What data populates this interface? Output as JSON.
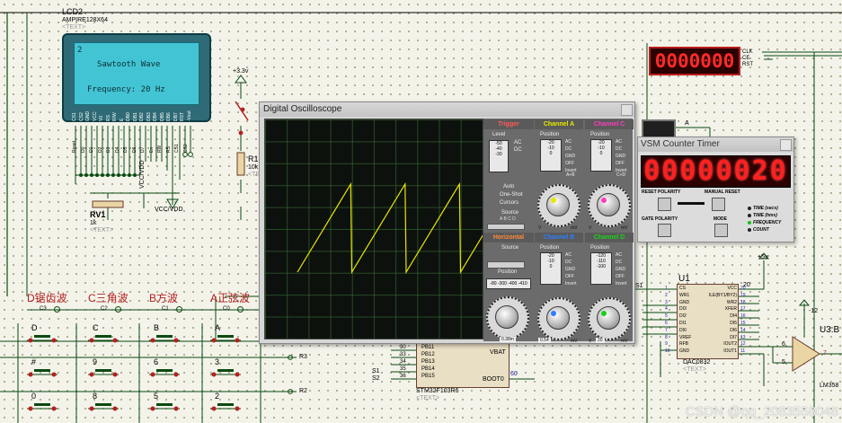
{
  "lcd": {
    "ref": "LCD2",
    "part": "AMPIRE128X64",
    "text_tag": "<TEXT>",
    "line0": "2",
    "line1": "Sawtooth Wave",
    "line2": "Frequency: 20 Hz",
    "pins": [
      "CS1",
      "CS2",
      "GND",
      "VCC",
      "V0",
      "RS",
      "R/W",
      "E",
      "DB0",
      "DB1",
      "DB2",
      "DB3",
      "DB4",
      "DB5",
      "DB6",
      "DB7",
      "RST",
      "-Vout"
    ],
    "nets": [
      "Reset",
      "D0",
      "D1",
      "D2",
      "D3",
      "D4",
      "D5",
      "D6",
      "D7",
      "En",
      "RW",
      "RS",
      "CS1",
      "CS2"
    ]
  },
  "schematic": {
    "supply_3v3": "+3.3v",
    "r1_ref": "R1",
    "r1_val": "10k",
    "r1_tag": "<TEXT>",
    "rv1_ref": "RV1",
    "rv1_val": "1k",
    "rv1_tag": "<TEXT>",
    "vcc_label": "VCC/VDD",
    "vcc_label2": "VCC/VDD",
    "wave_buttons": [
      {
        "title": "D锯齿波",
        "net": "C3"
      },
      {
        "title": "C三角波",
        "net": "C2"
      },
      {
        "title": "B方波",
        "net": "C1"
      },
      {
        "title": "A正弦波",
        "net": "C0"
      }
    ],
    "keypad_row1": [
      "D",
      "C",
      "B",
      "A"
    ],
    "keypad_row2": [
      "#",
      "9",
      "6",
      "3"
    ],
    "keypad_row3": [
      "0",
      "8",
      "5",
      "2"
    ],
    "net_r3": "R3",
    "net_r2": "R2",
    "s1": "S1",
    "s2": "S2",
    "mcu_pins": [
      "PB11",
      "PB12",
      "PB13",
      "PB14",
      "PB15"
    ],
    "mcu_pin_nums": [
      "30",
      "33",
      "34",
      "35",
      "36"
    ],
    "mcu_vbat": "VBAT",
    "mcu_boot": "BOOT0",
    "mcu_boot_num": "60",
    "mcu_part": "STM32F103R6",
    "mcu_tag": "<TEXT>",
    "counter_pins": [
      "CLK",
      "CE",
      "RST"
    ],
    "counter_value": "0000000",
    "probe_a": "A",
    "supply_5v": "+5v",
    "supply_m12": "-12",
    "dac_ref": "U1",
    "dac_part": "DAC0832",
    "dac_tag": "<TEXT>",
    "dac_left_pins": [
      "CS",
      "WR1",
      "GND",
      "DI3",
      "DI2",
      "DI1",
      "DI0",
      "VREF",
      "RFB",
      "GND"
    ],
    "dac_left_nums": [
      "1",
      "2",
      "3",
      "4",
      "5",
      "6",
      "7",
      "8",
      "9",
      "10"
    ],
    "dac_right_pins": [
      "VCC",
      "ILE(BY1/BY2)",
      "WR2",
      "XFER",
      "DI4",
      "DI5",
      "DI6",
      "DI7",
      "IOUT2",
      "IOUT1"
    ],
    "dac_right_nums": [
      "20",
      "19",
      "18",
      "17",
      "16",
      "15",
      "14",
      "13",
      "12",
      "11"
    ],
    "dac_net_s1": "S1",
    "opamp_ref": "U3:B",
    "opamp_part": "LM358",
    "opamp_pins": [
      "6",
      "5",
      "7"
    ],
    "vcc_20": "20"
  },
  "oscilloscope": {
    "title": "Digital Oscilloscope",
    "trigger_label": "Trigger",
    "level_label": "Level",
    "trigger_vals": [
      "-50",
      "-40",
      "-30"
    ],
    "ac_dc": [
      "AC",
      "DC"
    ],
    "auto": "Auto",
    "one_shot": "One-Shot",
    "cursors": "Cursors",
    "source": "Source",
    "source_opts": "A B C D",
    "channels": [
      {
        "name": "Channel A",
        "color": "#e8e800",
        "pos": [
          "-20",
          "-10",
          "0"
        ],
        "modes": [
          "AC",
          "DC",
          "GND",
          "OFF",
          "Invert"
        ],
        "scale": "V",
        "unit": "mV"
      },
      {
        "name": "Channel C",
        "color": "#ff3cbf",
        "pos": [
          "-20",
          "-10",
          "0"
        ],
        "modes": [
          "AC",
          "DC",
          "GND",
          "OFF",
          "Invert"
        ],
        "scale": "V",
        "unit": "mV"
      },
      {
        "name": "Channel B",
        "color": "#2f7fff",
        "pos": [
          "-20",
          "-10",
          "0"
        ],
        "modes": [
          "AC",
          "DC",
          "GND",
          "OFF",
          "Invert"
        ],
        "scale": "V",
        "unit": "mV"
      },
      {
        "name": "Channel D",
        "color": "#18d218",
        "pos": [
          "-120",
          "-110",
          "-100"
        ],
        "modes": [
          "AC",
          "DC",
          "GND",
          "OFF",
          "Invert"
        ],
        "scale": "V",
        "unit": "mV"
      }
    ],
    "a_plus_b": "A+B",
    "c_plus_d": "C+D",
    "horizontal": "Horizontal",
    "position": "Position",
    "h_pos": "-80 -300 -400 -410",
    "timebase_readout": "0.38m",
    "timebase_unit": "ms",
    "chA_readout": "0.54",
    "chB_readout": "20",
    "s1_label": "S1"
  },
  "counter": {
    "title": "VSM Counter Timer",
    "display": "00000020",
    "reset_polarity": "RESET POLARITY",
    "manual_reset": "MANUAL RESET",
    "gate_polarity": "GATE POLARITY",
    "mode": "MODE",
    "modes": [
      "TIME (secs)",
      "TIME (hms)",
      "FREQUENCY",
      "COUNT"
    ]
  },
  "watermark": "CSDN @qq_2083558048",
  "colors": {
    "bg": "#f3f3ea",
    "wire": "#0a4a10",
    "wave": "#e8e800",
    "lcd": "#43c4d4",
    "red_display": "#ff2020"
  }
}
